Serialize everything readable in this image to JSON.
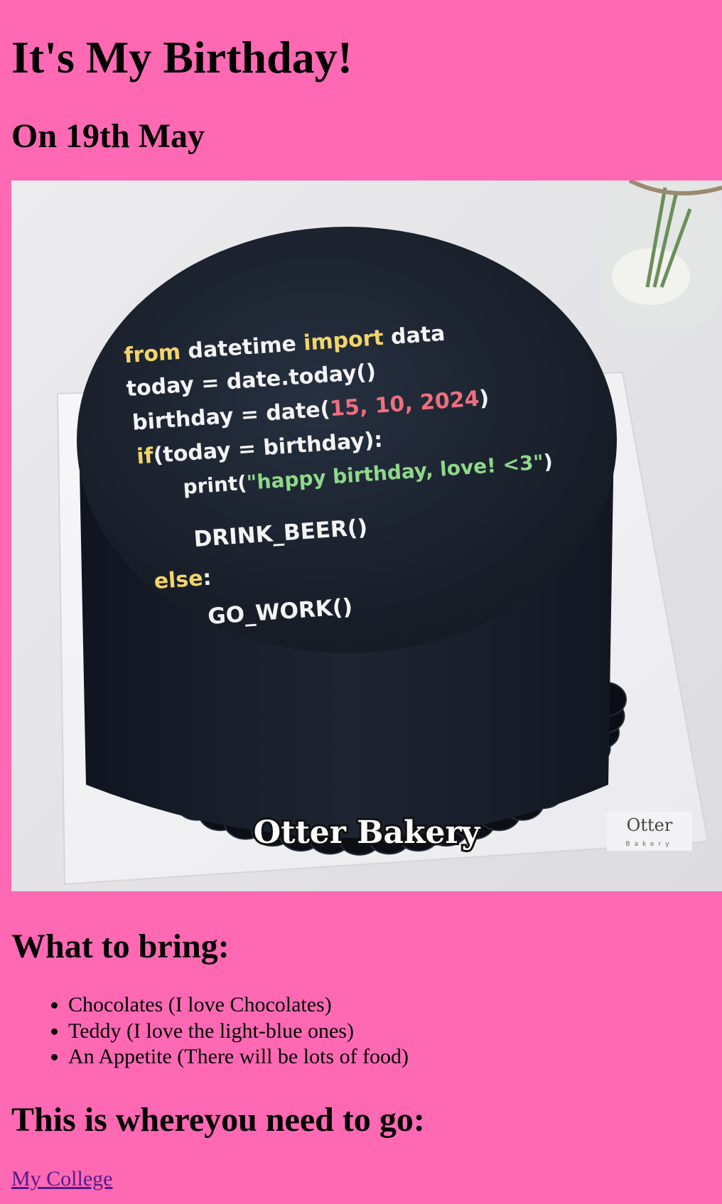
{
  "page": {
    "title": "It's My Birthday!",
    "subtitle": "On 19th May"
  },
  "photo": {
    "code_lines": [
      {
        "parts": [
          {
            "text": "from",
            "color": "#f3d46b"
          },
          {
            "text": " datetime ",
            "color": "#f4f4f4"
          },
          {
            "text": "import",
            "color": "#f3d46b"
          },
          {
            "text": " data",
            "color": "#f4f4f4"
          }
        ]
      },
      {
        "parts": [
          {
            "text": "today = date.today()",
            "color": "#f4f4f4"
          }
        ]
      },
      {
        "parts": [
          {
            "text": "birthday = date(",
            "color": "#f4f4f4"
          },
          {
            "text": "15, 10, 2024",
            "color": "#ee6f7f"
          },
          {
            "text": ")",
            "color": "#f4f4f4"
          }
        ]
      },
      {
        "parts": [
          {
            "text": "if",
            "color": "#f3d46b"
          },
          {
            "text": "(today = birthday):",
            "color": "#f4f4f4"
          }
        ]
      },
      {
        "parts": [
          {
            "text": "print(",
            "color": "#f4f4f4"
          },
          {
            "text": "\"happy birthday, love! <3\"",
            "color": "#8fd88a"
          },
          {
            "text": ")",
            "color": "#f4f4f4"
          }
        ]
      },
      {
        "parts": [
          {
            "text": "DRINK_BEER()",
            "color": "#f4f4f4"
          }
        ]
      },
      {
        "parts": [
          {
            "text": "else",
            "color": "#f3d46b"
          },
          {
            "text": ":",
            "color": "#f4f4f4"
          }
        ]
      },
      {
        "parts": [
          {
            "text": "GO_WORK()",
            "color": "#f4f4f4"
          }
        ]
      }
    ],
    "caption": "Otter Bakery",
    "board_logo": "Otter",
    "board_logo_sub": "Bakery"
  },
  "bring": {
    "heading": "What to bring:",
    "items": [
      "Chocolates (I love Chocolates)",
      "Teddy (I love the light-blue ones)",
      "An Appetite (There will be lots of food)"
    ]
  },
  "directions": {
    "heading": "This is whereyou need to go:",
    "link_text": "My College"
  },
  "colors": {
    "background": "#ff69b4",
    "link": "#551a8b"
  }
}
